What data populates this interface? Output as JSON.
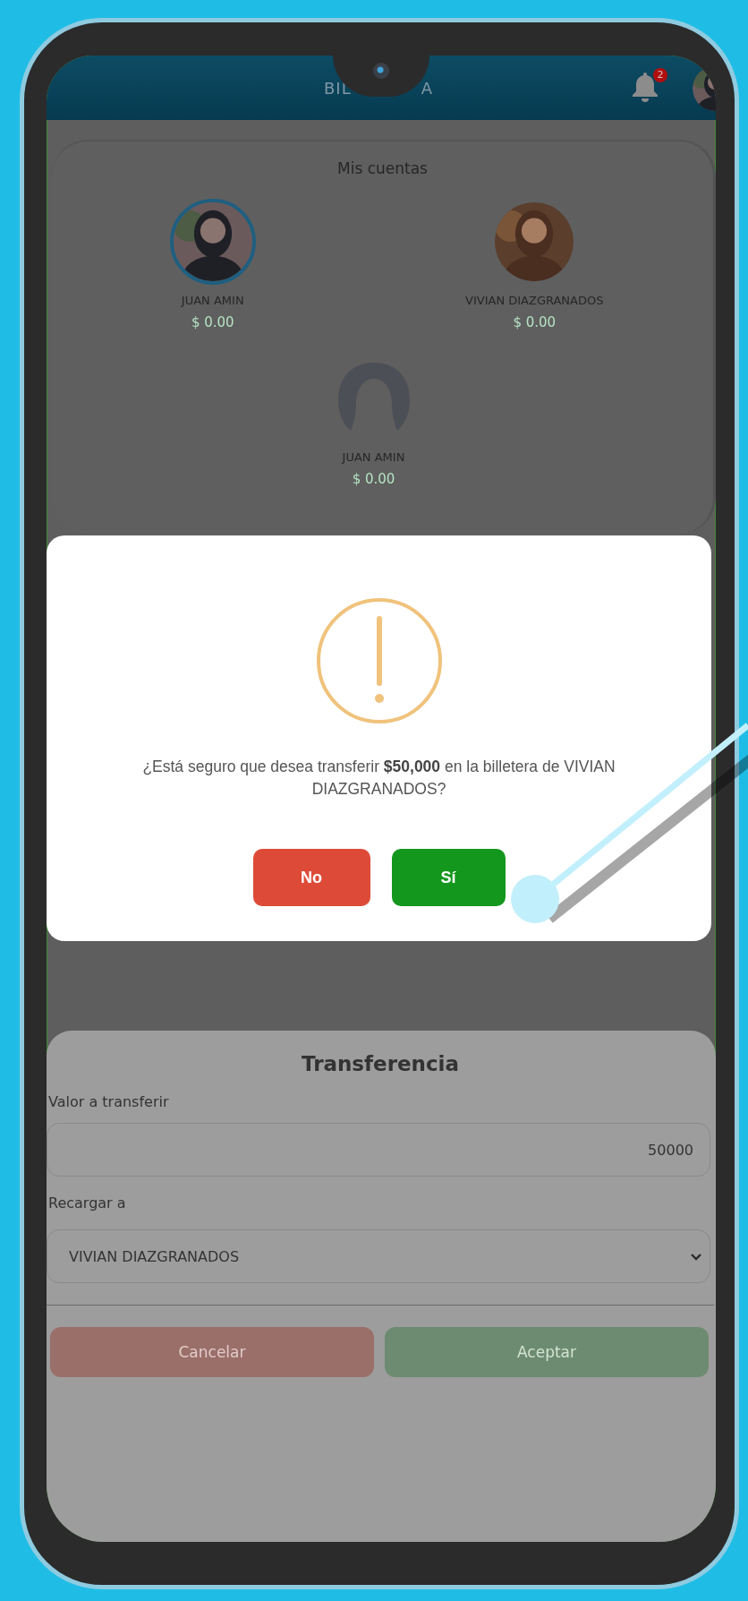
{
  "header": {
    "title_parts": [
      "BIL",
      "A"
    ],
    "notification_count": "2"
  },
  "accounts": {
    "title": "Mis cuentas",
    "items": [
      {
        "name": "JUAN AMIN",
        "balance": "$ 0.00",
        "selected": true
      },
      {
        "name": "VIVIAN DIAZGRANADOS",
        "balance": "$ 0.00",
        "selected": false
      },
      {
        "name": "JUAN AMIN",
        "balance": "$ 0.00",
        "kind": "silhouette",
        "selected": false
      }
    ]
  },
  "dialog": {
    "message": "¿Está seguro que desea transferir **$50,000** en la billetera de VIVIAN DIAZGRANADOS?",
    "buttons": [
      {
        "label": "No",
        "kind": "cancel"
      },
      {
        "label": "Sí",
        "kind": "confirm"
      }
    ]
  },
  "transfer": {
    "title": "Transferencia",
    "amount_label": "Valor a transferir",
    "amount_value": "50000",
    "recipient_label": "Recargar a",
    "recipient_value": "VIVIAN DIAZGRANADOS",
    "buttons": [
      {
        "label": "Cancelar",
        "kind": "cancel",
        "disabled": true
      },
      {
        "label": "Aceptar",
        "kind": "confirm",
        "disabled": true
      }
    ]
  }
}
